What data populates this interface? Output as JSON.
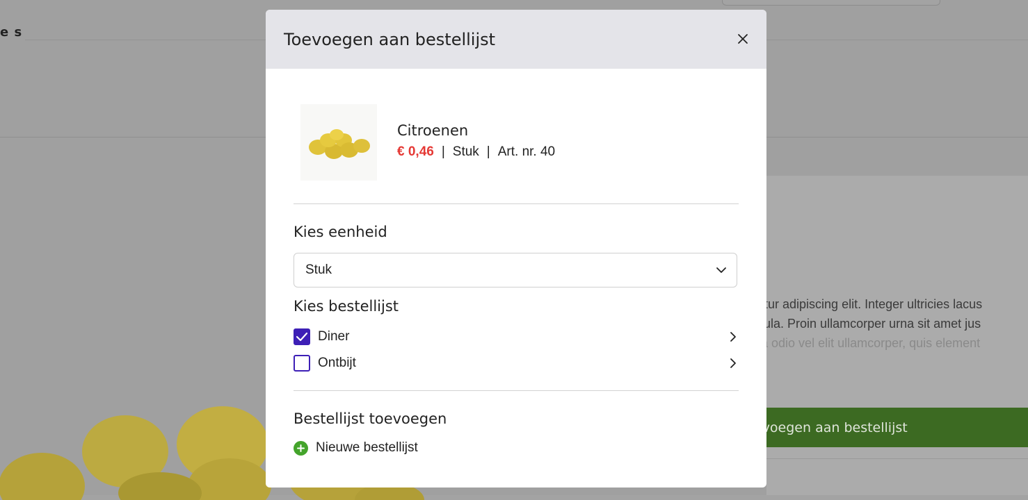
{
  "background": {
    "heading_fragment": "e s",
    "text_lines": [
      "tetur adipiscing elit. Integer ultricies lacus",
      "igula. Proin ullamcorper urna sit amet jus",
      "da odio vel elit ullamcorper, quis element"
    ],
    "add_button_label": "evoegen aan bestellijst"
  },
  "modal": {
    "title": "Toevoegen aan bestellijst",
    "close_icon": "close-icon",
    "product": {
      "name": "Citroenen",
      "price": "€ 0,46",
      "separator": "|",
      "unit": "Stuk",
      "article": "Art. nr. 40",
      "image_icon": "lemons-image"
    },
    "unit_section": {
      "label": "Kies eenheid",
      "selected": "Stuk"
    },
    "list_section": {
      "label": "Kies bestellijst",
      "items": [
        {
          "label": "Diner",
          "checked": true
        },
        {
          "label": "Ontbijt",
          "checked": false
        }
      ]
    },
    "add_section": {
      "label": "Bestellijst toevoegen",
      "new_list_label": "Nieuwe bestellijst"
    }
  },
  "colors": {
    "accent_purple": "#3d1fb6",
    "price_red": "#e53935",
    "add_green": "#44a42b",
    "header_gray": "#e4e4e9"
  }
}
